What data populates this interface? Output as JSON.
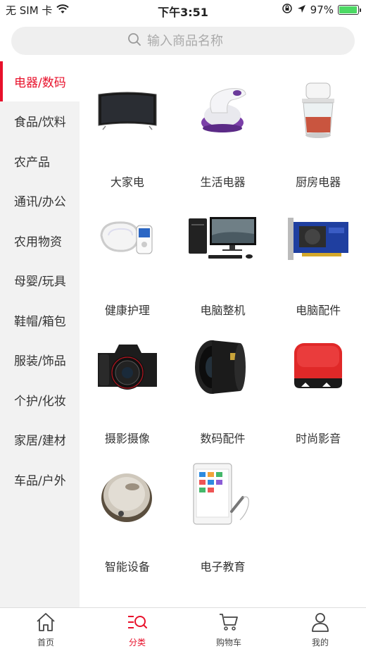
{
  "status_bar": {
    "carrier": "无 SIM 卡",
    "time": "下午3:51",
    "battery": "97%",
    "battery_level": 0.97
  },
  "search": {
    "placeholder": "输入商品名称"
  },
  "sidebar": {
    "items": [
      {
        "label": "电器/数码"
      },
      {
        "label": "食品/饮料"
      },
      {
        "label": "农产品"
      },
      {
        "label": "通讯/办公"
      },
      {
        "label": "农用物资"
      },
      {
        "label": "母婴/玩具"
      },
      {
        "label": "鞋帽/箱包"
      },
      {
        "label": "服装/饰品"
      },
      {
        "label": "个护/化妆"
      },
      {
        "label": "家居/建材"
      },
      {
        "label": "车品/户外"
      }
    ]
  },
  "grid": {
    "items": [
      {
        "label": "大家电",
        "icon": "tv-icon"
      },
      {
        "label": "生活电器",
        "icon": "lint-remover-icon"
      },
      {
        "label": "厨房电器",
        "icon": "food-chopper-icon"
      },
      {
        "label": "健康护理",
        "icon": "neck-massager-icon"
      },
      {
        "label": "电脑整机",
        "icon": "desktop-computer-icon"
      },
      {
        "label": "电脑配件",
        "icon": "graphics-card-icon"
      },
      {
        "label": "摄影摄像",
        "icon": "camera-icon"
      },
      {
        "label": "数码配件",
        "icon": "lens-icon"
      },
      {
        "label": "时尚影音",
        "icon": "speaker-icon"
      },
      {
        "label": "智能设备",
        "icon": "robot-vacuum-icon"
      },
      {
        "label": "电子教育",
        "icon": "learning-tablet-icon"
      }
    ]
  },
  "tabbar": {
    "items": [
      {
        "label": "首页",
        "icon": "home-icon"
      },
      {
        "label": "分类",
        "icon": "category-icon"
      },
      {
        "label": "购物车",
        "icon": "cart-icon"
      },
      {
        "label": "我的",
        "icon": "user-icon"
      }
    ]
  },
  "colors": {
    "accent": "#e8112b",
    "sidebar_bg": "#f2f2f2",
    "search_bg": "#efefef"
  }
}
